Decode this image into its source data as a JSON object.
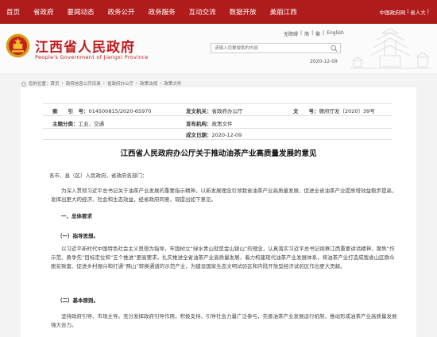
{
  "nav": {
    "items": [
      "首页",
      "省政府",
      "要闻动态",
      "政务公开",
      "政务服务",
      "互动交流",
      "数据开放",
      "美丽江西"
    ],
    "util": [
      "中国政府网",
      "|",
      "省人大",
      "|"
    ]
  },
  "header": {
    "site_name": "江西省人民政府",
    "site_name_en": "People's Government of Jiangxi Province",
    "util_links": [
      "无障碍",
      "|",
      "简",
      "|",
      "繁",
      "|",
      "English"
    ],
    "search_placeholder": "请输入您要搜索的内容",
    "date": "2020-12-09"
  },
  "breadcrumb": {
    "label": "您的位置：",
    "items": [
      "首页",
      "政府信息公开目录",
      "省政府办公厅",
      "政策法规",
      "政策文件"
    ],
    "sep": "›"
  },
  "meta": {
    "index_label": "索　　引　号：",
    "index_value": "014500815/2020-65970",
    "org_label": "发文机关：",
    "org_value": "省政府办公厅",
    "num_label": "文　　号：",
    "num_value": "赣府厅发〔2020〕39号",
    "topic_label": "主题分类：",
    "topic_value": "工业、交通",
    "date_label": "成文日期：",
    "date_value": "2020-12-09",
    "type_label": "发布机构：",
    "type_value": "政策文件"
  },
  "doc": {
    "title": "江西省人民政府办公厅关于推动油茶产业高质量发展的意见",
    "salutation": "各市、县（区）人民政府，省政府各部门：",
    "intro": "为深入贯彻习近平总书记关于油茶产业发展的重要指示精神，以新发展理念引领我省油茶产业高质量发展，促进全省油茶产业提质增效益稳步提高，发挥出更大的经济、社会和生态效益，经省政府同意，现提出如下意见。",
    "section1": "一、总体要求",
    "sub1": "（一）指导思想。",
    "para1": "以习近平新时代中国特色社会主义思想为指导，牢固树立“绿水青山就是金山银山”的理念，认真落实习近平总书记视察江西重要讲话精神，聚焦“作示范、勇争先”目标定位和“五个推进”更高要求，扎实推进全省油茶产业高质量发展，着力构建现代油茶产业发展体系，将油茶产业打造成我省山区群众脱贫致富、促进乡村振兴和打通“两山”转换通道的示范产业，为建设国家生态文明试验区和内陆开放型经济试验区作出更大贡献。",
    "sub2": "（二）基本原则。",
    "para2": "坚持政府引导、市场主导。充分发挥政府引导作用，积极支持、引导社会力量广泛参与，完善油茶产业发展运行机制，推动形成油茶产业高质量发展强大合力。"
  }
}
